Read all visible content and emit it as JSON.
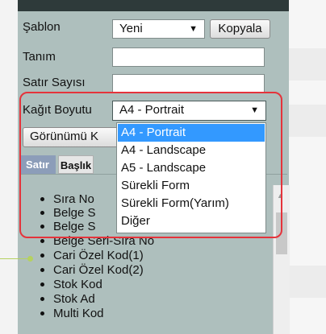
{
  "form": {
    "sablon_label": "Şablon",
    "sablon_value": "Yeni",
    "kopyala_label": "Kopyala",
    "tanim_label": "Tanım",
    "satir_sayisi_label": "Satır Sayısı",
    "kagit_boyutu_label": "Kağıt Boyutu",
    "kagit_boyutu_value": "A4 - Portrait",
    "gorunumu_label": "Görünümü K"
  },
  "tabs": {
    "satir": "Satır",
    "baslik": "Başlık"
  },
  "dropdown": {
    "options": [
      "A4 - Portrait",
      "A4 - Landscape",
      "A5 - Landscape",
      "Sürekli Form",
      "Sürekli Form(Yarım)",
      "Diğer"
    ],
    "selected_index": 0
  },
  "list": {
    "items": [
      "Sıra No",
      "Belge S",
      "Belge S",
      "Belge Seri-Sıra No",
      "Cari Özel Kod(1)",
      "Cari Özel Kod(2)",
      "Stok Kod",
      "Stok Ad",
      "Multi Kod"
    ]
  },
  "icons": {
    "dropdown_caret": "▼",
    "scroll_up": "▲"
  },
  "colors": {
    "panel_bg": "#aebfbd",
    "selection": "#3399ff",
    "highlight_border": "#e5333b",
    "pointer": "#b5d160"
  }
}
